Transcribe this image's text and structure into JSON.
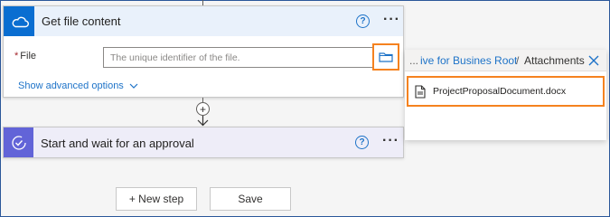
{
  "step1": {
    "title": "Get file content",
    "help": "?",
    "more": "···",
    "file_label": "File",
    "file_required": "*",
    "file_placeholder": "The unique identifier of the file.",
    "file_value": "",
    "advanced_label": "Show advanced options",
    "icon": "onedrive-cloud-icon"
  },
  "connector": {
    "plus": "+"
  },
  "step2": {
    "title": "Start and wait for an approval",
    "help": "?",
    "more": "···",
    "icon": "approval-icon"
  },
  "buttons": {
    "new_step": "+ New step",
    "save": "Save"
  },
  "picker": {
    "ellipsis": "...",
    "breadcrumb_parent": "ive for Busines Root",
    "separator": "/",
    "breadcrumb_current": "Attachments",
    "items": [
      {
        "name": "ProjectProposalDocument.docx",
        "icon": "document-icon"
      }
    ]
  },
  "colors": {
    "accent_blue": "#1e73c8",
    "onedrive_blue": "#0a6ed1",
    "approval_purple": "#6264d8",
    "highlight_orange": "#f5821f"
  }
}
